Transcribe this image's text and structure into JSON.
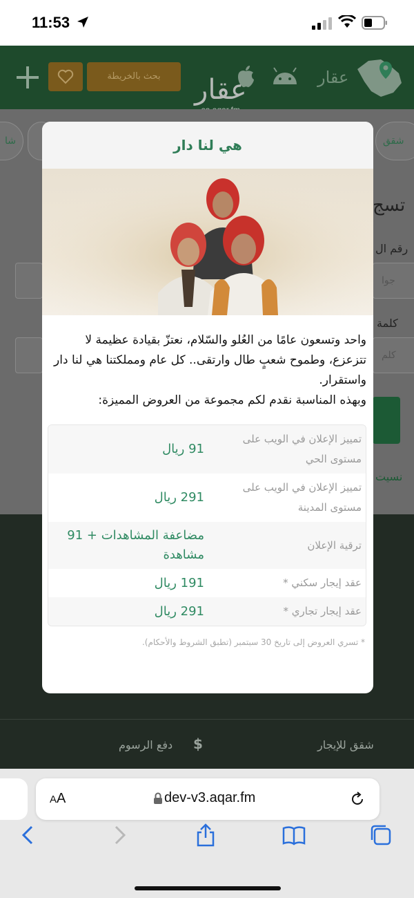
{
  "status_bar": {
    "time": "11:53"
  },
  "header": {
    "brand_name": "عقار",
    "map_button_label": "بحث بالخريطة",
    "watermark_word": "عقار",
    "watermark_url": "sa.aqar.fm"
  },
  "background_page": {
    "chips": [
      "شقق",
      "شا"
    ],
    "heading": "تسج",
    "phone_label": "رقم ال",
    "phone_placeholder": "جوا",
    "password_label": "كلمة",
    "password_placeholder": "كلم",
    "link_text": "نسيت",
    "footer_left": "دفع الرسوم",
    "footer_right": "شقق للإيجار"
  },
  "modal": {
    "title": "هي لنا دار",
    "paragraph": "واحد وتسعون عامًا من العُلو والسّلام، نعتزّ بقيادة عظيمة لا تتزعزع، وطموح شعبٍ طال وارتقى.. كل عام ومملكتنا هي لنا دار واستقرار.",
    "intro": "وبهذه المناسبة نقدم لكم مجموعة من العروض المميزة:",
    "offers": [
      {
        "label": "تمييز الإعلان في الويب على مستوى الحي",
        "price": "91 ريال"
      },
      {
        "label": "تمييز الإعلان في الويب على مستوى المدينة",
        "price": "291 ريال"
      },
      {
        "label": "ترقية الإعلان",
        "price": "مضاعفة المشاهدات + 91 مشاهدة"
      },
      {
        "label": "عقد إيجار سكني *",
        "price": "191 ريال"
      },
      {
        "label": "عقد إيجار تجاري *",
        "price": "291 ريال"
      }
    ],
    "note": "* تسري العروض إلى تاريخ 30 سبتمبر (تطبق الشروط والأحكام)."
  },
  "browser": {
    "aa_label_small": "A",
    "aa_label_big": "A",
    "url": "dev-v3.aqar.fm"
  },
  "colors": {
    "brand_green": "#2f7d57",
    "price_green": "#2f8a62",
    "header_green": "#1e4a2c",
    "accent_gold": "#7a5a1c"
  }
}
